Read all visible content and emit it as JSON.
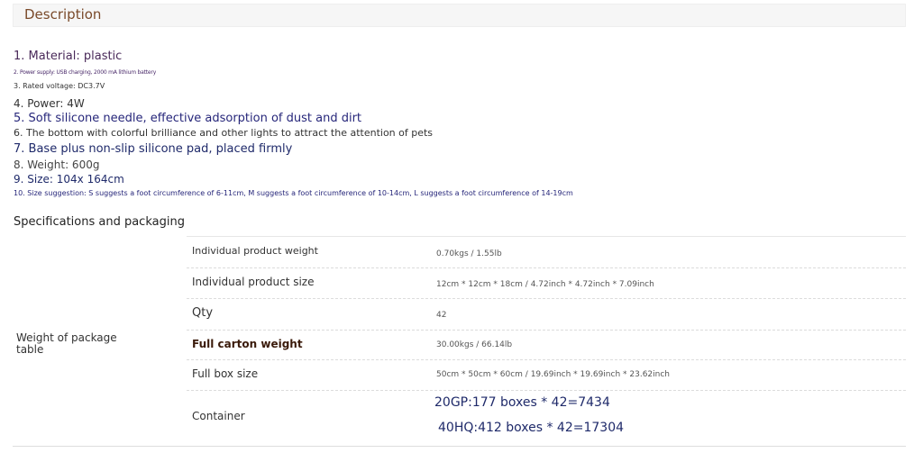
{
  "header": {
    "title": "Description"
  },
  "description": {
    "lines": [
      "1. Material: plastic",
      "2. Power supply: USB charging, 2000 mA lithium battery",
      "3. Rated voltage: DC3.7V",
      "4. Power: 4W",
      "5. Soft silicone needle, effective adsorption of dust and dirt",
      "6. The bottom with colorful brilliance and other lights to attract the attention of pets",
      "7. Base plus non-slip silicone pad, placed firmly",
      "8. Weight: 600g",
      "9. Size: 104x 164cm",
      "10. Size suggestion: S suggests a foot circumference of 6-11cm, M suggests a foot circumference of 10-14cm, L suggests a foot circumference of 14-19cm"
    ]
  },
  "specs": {
    "title": "Specifications and packaging",
    "row_label": "Weight of package table",
    "rows": [
      {
        "key": "Individual product weight",
        "value": "0.70kgs / 1.55lb"
      },
      {
        "key": "Individual product size",
        "value": "12cm * 12cm * 18cm / 4.72inch * 4.72inch * 7.09inch"
      },
      {
        "key": "Qty",
        "value": "42"
      },
      {
        "key": "Full carton weight",
        "value": "30.00kgs / 66.14lb"
      },
      {
        "key": "Full box size",
        "value": "50cm * 50cm * 60cm / 19.69inch * 19.69inch * 23.62inch"
      },
      {
        "key": "Container",
        "values": [
          "20GP:177 boxes * 42=7434",
          "40HQ:412 boxes * 42=17304"
        ]
      }
    ]
  }
}
